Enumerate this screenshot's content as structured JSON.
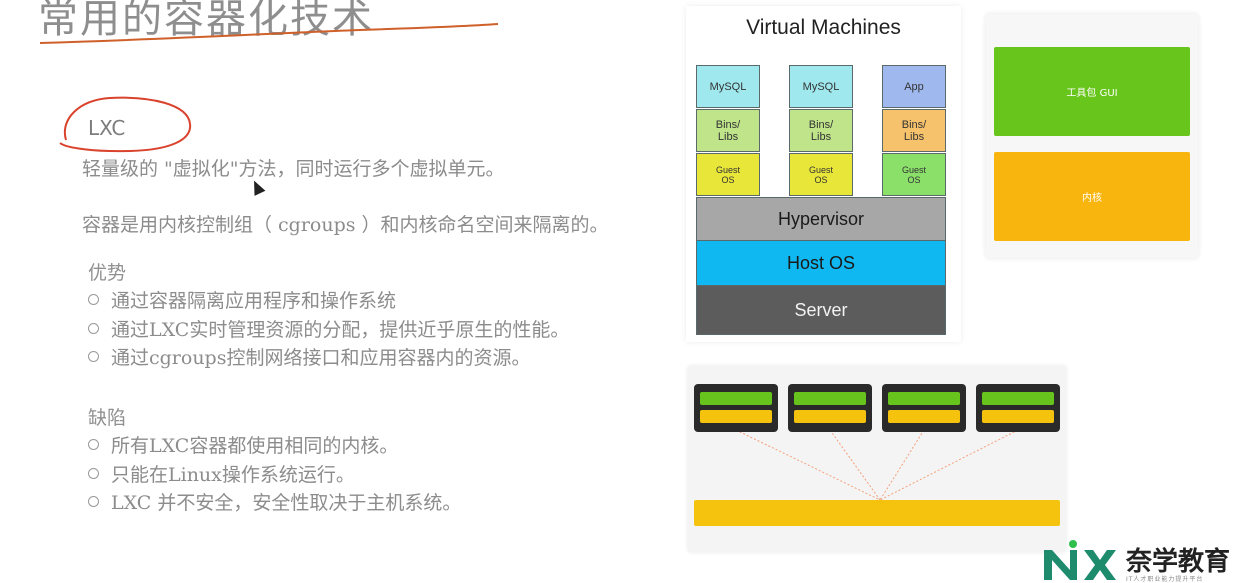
{
  "slide": {
    "title": "常用的容器化技术",
    "subtitle": "LXC",
    "intro_lines": [
      "轻量级的 \"虚拟化\"方法，同时运行多个虚拟单元。",
      "容器是用内核控制组（ cgroups ）和内核命名空间来隔离的。"
    ],
    "advantages": {
      "heading": "优势",
      "items": [
        "通过容器隔离应用程序和操作系统",
        "通过LXC实时管理资源的分配，提供近乎原生的性能。",
        "通过cgroups控制网络接口和应用容器内的资源。"
      ]
    },
    "defects": {
      "heading": "缺陷",
      "items": [
        "所有LXC容器都使用相同的内核。",
        "只能在Linux操作系统运行。",
        "LXC 并不安全，安全性取决于主机系统。"
      ]
    }
  },
  "vm_diagram": {
    "title": "Virtual Machines",
    "columns": [
      {
        "app": "MySQL",
        "bins": "Bins/\nLibs",
        "guest": "Guest\nOS"
      },
      {
        "app": "MySQL",
        "bins": "Bins/\nLibs",
        "guest": "Guest\nOS"
      },
      {
        "app": "App",
        "bins": "Bins/\nLibs",
        "guest": "Guest\nOS"
      }
    ],
    "layers": {
      "hypervisor": "Hypervisor",
      "host_os": "Host OS",
      "server": "Server"
    },
    "colors": {
      "app_cyan": "#9ee8ee",
      "app_blue": "#9fb9ef",
      "bins_green": "#bfe48a",
      "bins_orange": "#f6c26c",
      "guest_green": "#8be06a",
      "guest_yellow": "#e9e63a",
      "hypervisor": "#a7a7a7",
      "host_os": "#10b8f2",
      "server": "#5c5c5c"
    }
  },
  "right_panel": {
    "toolkit_label": "工具包  GUI",
    "kernel_label": "内核",
    "colors": {
      "toolkit": "#68c51c",
      "kernel": "#f8b50d"
    }
  },
  "brand": {
    "name": "奈学教育",
    "tagline": "IT人才职业能力提升平台"
  }
}
